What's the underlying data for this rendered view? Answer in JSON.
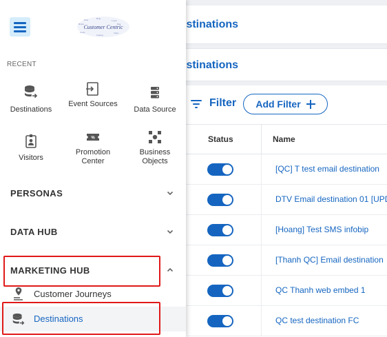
{
  "page": {
    "title": "Destinations",
    "sub_title": "Destinations"
  },
  "filter": {
    "label": "Filter",
    "add_label": "Add Filter"
  },
  "table": {
    "headers": [
      "Status",
      "Name"
    ],
    "rows": [
      {
        "enabled": true,
        "name": "[QC] T test email destination"
      },
      {
        "enabled": true,
        "name": "DTV Email destination 01 [UPD"
      },
      {
        "enabled": true,
        "name": "[Hoang] Test SMS infobip"
      },
      {
        "enabled": true,
        "name": "[Thanh QC] Email destination"
      },
      {
        "enabled": true,
        "name": "QC Thanh web embed 1"
      },
      {
        "enabled": true,
        "name": "QC test destination FC"
      }
    ]
  },
  "drawer": {
    "logo_text": "Customer Centric",
    "recent_label": "RECENT",
    "recent": [
      {
        "label": "Destinations",
        "icon": "database-arrow-icon"
      },
      {
        "label": "Event Sources",
        "icon": "import-icon"
      },
      {
        "label": "Data Source",
        "icon": "server-icon"
      },
      {
        "label": "Visitors",
        "icon": "visitor-badge-icon"
      },
      {
        "label": "Promotion Center",
        "icon": "ticket-percent-icon"
      },
      {
        "label": "Business Objects",
        "icon": "object-group-icon"
      }
    ],
    "sections": [
      {
        "label": "PERSONAS",
        "expanded": false
      },
      {
        "label": "DATA HUB",
        "expanded": false
      },
      {
        "label": "MARKETING HUB",
        "expanded": true
      }
    ],
    "marketing_items": [
      {
        "label": "Customer Journeys",
        "icon": "journey-pin-icon"
      },
      {
        "label": "Destinations",
        "icon": "database-arrow-icon",
        "active": true
      }
    ]
  },
  "colors": {
    "accent": "#1565c0",
    "highlight": "#e01818",
    "menu_button_bg": "#d4ecfb"
  }
}
